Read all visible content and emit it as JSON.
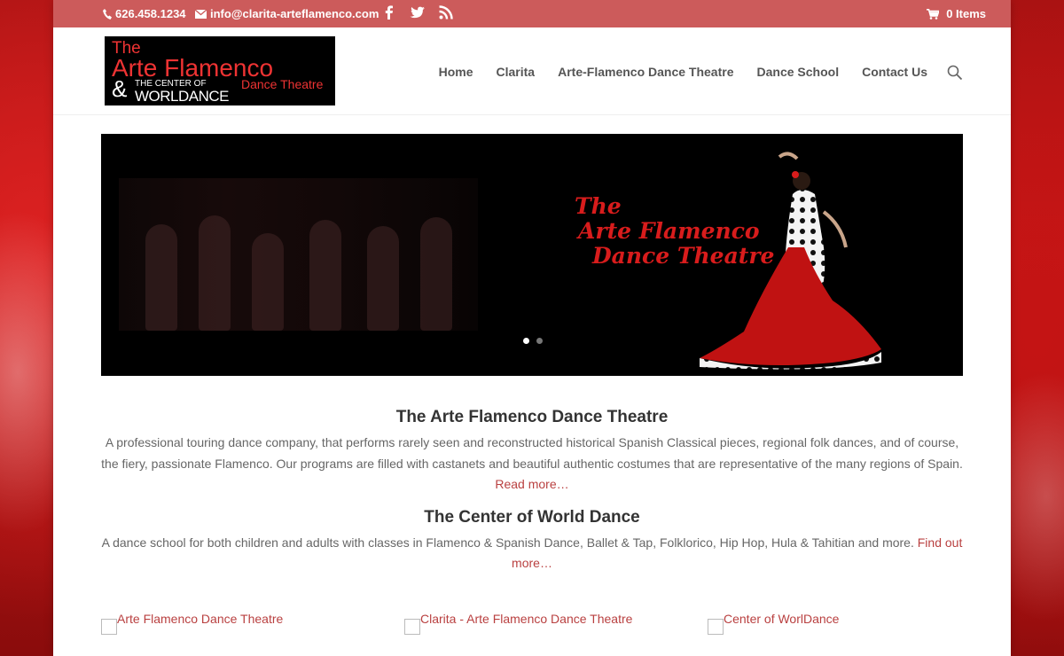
{
  "topbar": {
    "phone": "626.458.1234",
    "email": "info@clarita-arteflamenco.com",
    "social_icons": [
      "facebook-icon",
      "twitter-icon",
      "rss-icon"
    ],
    "cart": "0 Items"
  },
  "logo": {
    "line1": "The",
    "line2": "Arte Flamenco",
    "line3": "Dance Theatre",
    "amp": "&",
    "line4": "THE CENTER OF",
    "line5": "WORLDANCE"
  },
  "nav": {
    "items": [
      "Home",
      "Clarita",
      "Arte-Flamenco Dance Theatre",
      "Dance School",
      "Contact Us"
    ]
  },
  "slider": {
    "title_lines": [
      "The",
      "Arte Flamenco",
      "Dance Theatre"
    ],
    "slide_count": 2,
    "active_slide": 1
  },
  "sections": [
    {
      "heading": "The Arte Flamenco Dance Theatre",
      "text": "A professional touring dance company, that performs rarely seen and reconstructed historical Spanish Classical pieces, regional folk dances, and of course, the fiery, passionate Flamenco.   Our programs are filled with castanets and beautiful authentic costumes that are representative of the many regions of Spain. ",
      "link": "Read more…"
    },
    {
      "heading": "The Center of World Dance",
      "text": "A dance school for both children and adults with classes in Flamenco & Spanish Dance, Ballet & Tap, Folklorico, Hip Hop, Hula & Tahitian and more. ",
      "link": "Find out more…"
    }
  ],
  "images": [
    {
      "alt": "Arte Flamenco Dance Theatre"
    },
    {
      "alt": "Clarita - Arte Flamenco Dance Theatre"
    },
    {
      "alt": "Center of WorlDance"
    }
  ],
  "colors": {
    "topbar": "#cc5b5b",
    "accent": "#b94040",
    "slide_title": "#d81c1c"
  }
}
